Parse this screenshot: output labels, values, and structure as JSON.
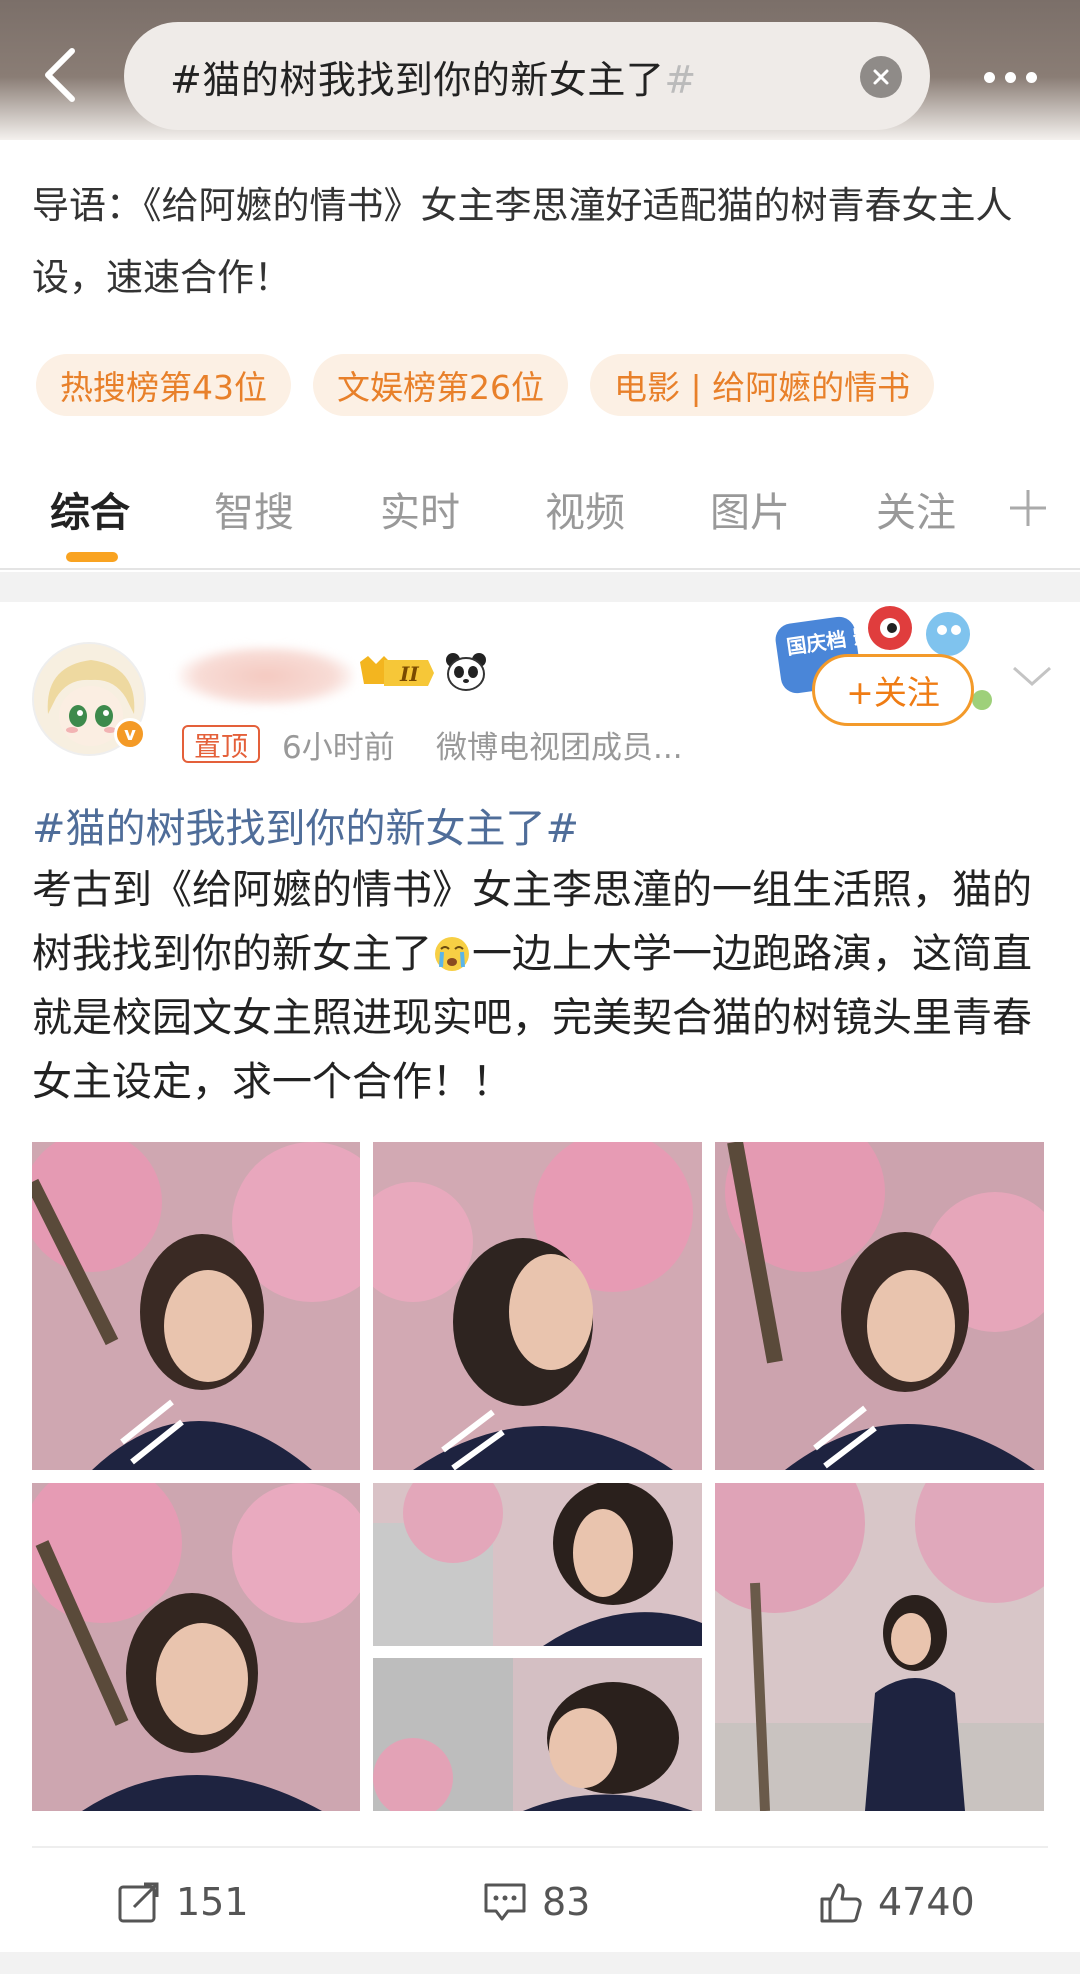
{
  "search": {
    "query": "#猫的树我找到你的新女主了",
    "query_suffix": "#"
  },
  "lead": {
    "text": "导语：《给阿嬷的情书》女主李思潼好适配猫的树青春女主人设，速速合作！"
  },
  "chips": [
    {
      "label": "热搜榜第43位"
    },
    {
      "label": "文娱榜第26位"
    },
    {
      "label": "电影 | 给阿嬷的情书"
    }
  ],
  "tabs": [
    {
      "label": "综合",
      "active": true
    },
    {
      "label": "智搜"
    },
    {
      "label": "实时"
    },
    {
      "label": "视频"
    },
    {
      "label": "图片"
    },
    {
      "label": "关注"
    }
  ],
  "post": {
    "pin_label": "置顶",
    "time": "6小时前",
    "source": "微博电视团成员...",
    "follow_label": "+关注",
    "rank_badge": "II",
    "hashtag": "#猫的树我找到你的新女主了#",
    "text_part1": "考古到《给阿嬷的情书》女主李思潼的一组生活照，猫的树我找到你的新女主了",
    "text_part2": "一边上大学一边跑路演，这简直就是校园文女主照进现实吧，完美契合猫的树镜头里青春女主设定，求一个合作！！",
    "promo_sticker_text": "国庆档 影评"
  },
  "actions": {
    "reposts": "151",
    "comments": "83",
    "likes": "4740"
  },
  "colors": {
    "accent": "#f9a321",
    "hashtag": "#4f6d99",
    "chip_text": "#e8802a",
    "chip_bg": "#fcf0e4",
    "follow": "#ef7c14"
  },
  "icons": [
    "back-arrow-icon",
    "clear-icon",
    "more-icon",
    "plus-icon",
    "panda-icon",
    "verified-icon",
    "chevron-down-icon",
    "share-icon",
    "comment-icon",
    "like-icon",
    "crying-emoji-icon"
  ]
}
